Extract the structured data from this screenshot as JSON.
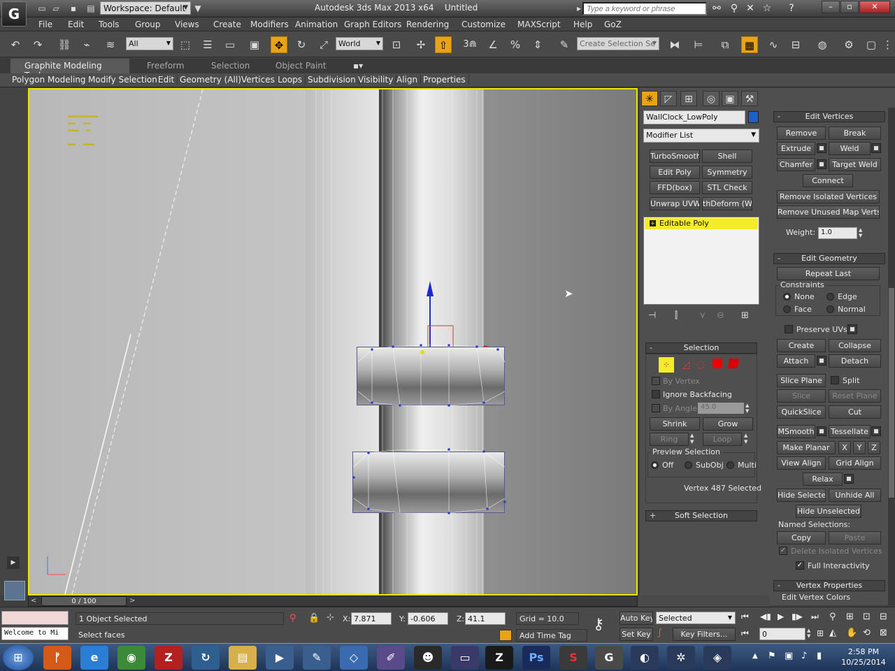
{
  "title_bar": {
    "app_title": "Autodesk 3ds Max  2013 x64",
    "file_name": "Untitled",
    "workspace": "Workspace: Default",
    "search_placeholder": "Type a keyword or phrase",
    "logo_text": "G"
  },
  "menu": [
    "File",
    "Edit",
    "Tools",
    "Group",
    "Views",
    "Create",
    "Modifiers",
    "Animation",
    "Graph Editors",
    "Rendering",
    "Customize",
    "MAXScript",
    "Help",
    "GoZ"
  ],
  "toolbar": {
    "selection_filter": "All",
    "reference_coord": "World",
    "named_selection_placeholder": "Create Selection Se",
    "snap_label": "3",
    "angle_snap_label": "%"
  },
  "ribbon": {
    "tabs": [
      "Graphite Modeling Tools",
      "Freeform",
      "Selection",
      "Object Paint"
    ],
    "buttons": [
      "Polygon Modeling",
      "Modify Selection",
      "Edit",
      "Geometry (All)",
      "Vertices",
      "Loops",
      "Subdivision",
      "Visibility",
      "Align",
      "Properties"
    ]
  },
  "viewport": {
    "border_color": "#f0e000",
    "axis_x": "x",
    "axis_z": "z"
  },
  "command_panel": {
    "object_name": "WallClock_LowPoly",
    "object_color": "#1e5fc8",
    "modifier_list": "Modifier List",
    "modifier_buttons": [
      "TurboSmooth",
      "Shell",
      "Edit Poly",
      "Symmetry",
      "FFD(box)",
      "STL Check",
      "Unwrap UVW",
      "thDeform (WSI"
    ],
    "stack_item": "Editable Poly",
    "selection": {
      "title": "Selection",
      "by_vertex": "By Vertex",
      "ignore_backfacing": "Ignore Backfacing",
      "by_angle": "By Angle:",
      "angle_value": "45.0",
      "shrink": "Shrink",
      "grow": "Grow",
      "ring": "Ring",
      "loop": "Loop",
      "preview_title": "Preview Selection",
      "preview_off": "Off",
      "preview_subobj": "SubObj",
      "preview_multi": "Multi",
      "status": "Vertex 487 Selected"
    },
    "soft_selection": "Soft Selection"
  },
  "edit_vertices": {
    "title": "Edit Vertices",
    "remove": "Remove",
    "break": "Break",
    "extrude": "Extrude",
    "weld": "Weld",
    "chamfer": "Chamfer",
    "target_weld": "Target Weld",
    "connect": "Connect",
    "remove_isolated": "Remove Isolated Vertices",
    "remove_unused": "Remove Unused Map Verts",
    "weight_label": "Weight:",
    "weight_value": "1.0"
  },
  "edit_geometry": {
    "title": "Edit Geometry",
    "repeat_last": "Repeat Last",
    "constraints": "Constraints",
    "none": "None",
    "edge": "Edge",
    "face": "Face",
    "normal": "Normal",
    "preserve_uvs": "Preserve UVs",
    "create": "Create",
    "collapse": "Collapse",
    "attach": "Attach",
    "detach": "Detach",
    "slice_plane": "Slice Plane",
    "split": "Split",
    "slice": "Slice",
    "reset_plane": "Reset Plane",
    "quickslice": "QuickSlice",
    "cut": "Cut",
    "msmooth": "MSmooth",
    "tessellate": "Tessellate",
    "make_planar": "Make Planar",
    "x": "X",
    "y": "Y",
    "z": "Z",
    "view_align": "View Align",
    "grid_align": "Grid Align",
    "relax": "Relax",
    "hide_selected": "Hide Selected",
    "unhide_all": "Unhide All",
    "hide_unselected": "Hide Unselected",
    "named_selections": "Named Selections:",
    "copy": "Copy",
    "paste": "Paste",
    "delete_isolated": "Delete Isolated Vertices",
    "full_interactivity": "Full Interactivity"
  },
  "vertex_properties": {
    "title": "Vertex Properties",
    "edit_vertex_colors": "Edit Vertex Colors"
  },
  "timeline": {
    "frame": "0 / 100"
  },
  "status": {
    "listener": "Welcome to Mi",
    "selected": "1 Object Selected",
    "prompt": "Select faces",
    "x_label": "X:",
    "x": "7.871",
    "y_label": "Y:",
    "y": "-0.606",
    "z_label": "Z:",
    "z": "41.1",
    "grid": "Grid = 10.0",
    "add_time_tag": "Add Time Tag",
    "auto_key": "Auto Key",
    "set_key": "Set Key",
    "key_mode": "Selected",
    "key_filters": "Key Filters...",
    "current_frame": "0"
  },
  "taskbar": {
    "time": "2:58 PM",
    "date": "10/25/2014"
  }
}
